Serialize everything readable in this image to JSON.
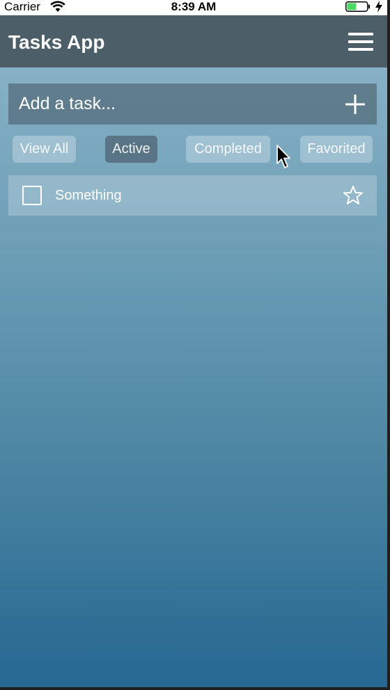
{
  "status_bar": {
    "carrier": "Carrier",
    "time": "8:39 AM",
    "battery_color": "#4cd964"
  },
  "header": {
    "title": "Tasks App",
    "menu_icon": "hamburger-menu-icon",
    "background": "#4c5f68"
  },
  "add_task": {
    "placeholder": "Add a task...",
    "add_icon": "plus-icon"
  },
  "filters": [
    {
      "label": "View All",
      "active": false
    },
    {
      "label": "Active",
      "active": true
    },
    {
      "label": "Completed",
      "active": false
    },
    {
      "label": "Favorited",
      "active": false
    }
  ],
  "tasks": [
    {
      "label": "Something",
      "completed": false,
      "favorited": false
    }
  ]
}
